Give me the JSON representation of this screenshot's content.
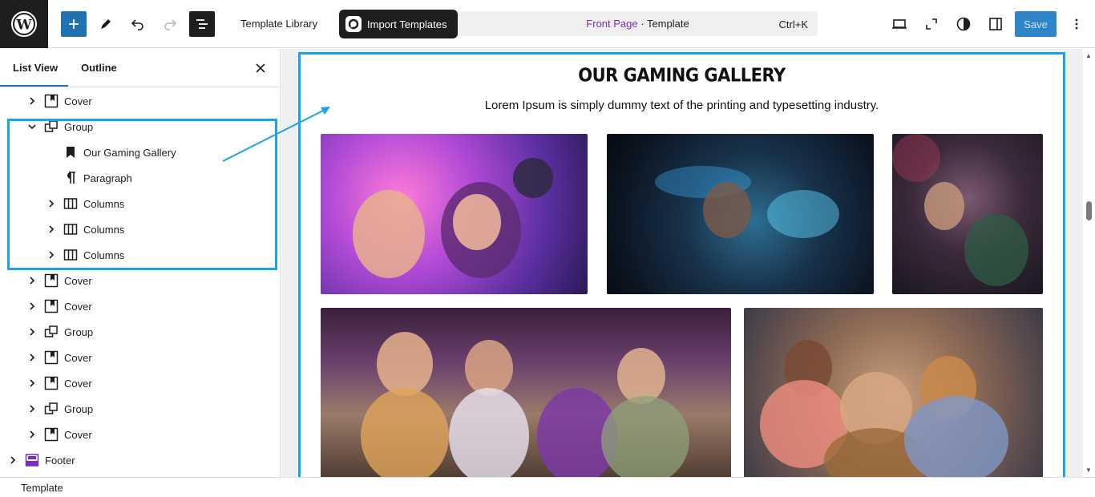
{
  "toolbar": {
    "template_library": "Template Library",
    "import_templates": "Import Templates",
    "command": {
      "page": "Front Page",
      "separator": " · ",
      "type": "Template",
      "shortcut": "Ctrl+K"
    },
    "save": "Save"
  },
  "panel": {
    "tabs": [
      "List View",
      "Outline"
    ],
    "active_tab": "List View",
    "tree": [
      {
        "label": "Cover",
        "icon": "cover-icon",
        "depth": 1,
        "expandable": true,
        "expanded": false
      },
      {
        "label": "Group",
        "icon": "group-icon",
        "depth": 1,
        "expandable": true,
        "expanded": true
      },
      {
        "label": "Our Gaming Gallery",
        "icon": "heading-bookmark-icon",
        "depth": 2,
        "expandable": false
      },
      {
        "label": "Paragraph",
        "icon": "paragraph-icon",
        "depth": 2,
        "expandable": false
      },
      {
        "label": "Columns",
        "icon": "columns-icon",
        "depth": 2,
        "expandable": true,
        "expanded": false
      },
      {
        "label": "Columns",
        "icon": "columns-icon",
        "depth": 2,
        "expandable": true,
        "expanded": false
      },
      {
        "label": "Columns",
        "icon": "columns-icon",
        "depth": 2,
        "expandable": true,
        "expanded": false
      },
      {
        "label": "Cover",
        "icon": "cover-icon",
        "depth": 1,
        "expandable": true,
        "expanded": false
      },
      {
        "label": "Cover",
        "icon": "cover-icon",
        "depth": 1,
        "expandable": true,
        "expanded": false
      },
      {
        "label": "Group",
        "icon": "group-icon",
        "depth": 1,
        "expandable": true,
        "expanded": false
      },
      {
        "label": "Cover",
        "icon": "cover-icon",
        "depth": 1,
        "expandable": true,
        "expanded": false
      },
      {
        "label": "Cover",
        "icon": "cover-icon",
        "depth": 1,
        "expandable": true,
        "expanded": false
      },
      {
        "label": "Group",
        "icon": "group-icon",
        "depth": 1,
        "expandable": true,
        "expanded": false
      },
      {
        "label": "Cover",
        "icon": "cover-icon",
        "depth": 1,
        "expandable": true,
        "expanded": false
      },
      {
        "label": "Footer",
        "icon": "footer-icon",
        "depth": 0,
        "expandable": true,
        "expanded": false
      }
    ]
  },
  "canvas": {
    "title": "OUR GAMING GALLERY",
    "subtitle": "Lorem Ipsum is simply dummy text of the printing and typesetting industry.",
    "photos": [
      "gaming-photo-neon-couple",
      "gaming-photo-esports-arena",
      "gaming-photo-lan-party",
      "gaming-photo-friends-couch",
      "gaming-photo-family-controllers"
    ]
  },
  "status": {
    "breadcrumb": "Template"
  },
  "colors": {
    "accent": "#2271b1",
    "highlight": "#1aa3e8",
    "page_link": "#7b2cbf",
    "dark": "#1e1e1e",
    "footer_icon": "#7b2cbf"
  }
}
